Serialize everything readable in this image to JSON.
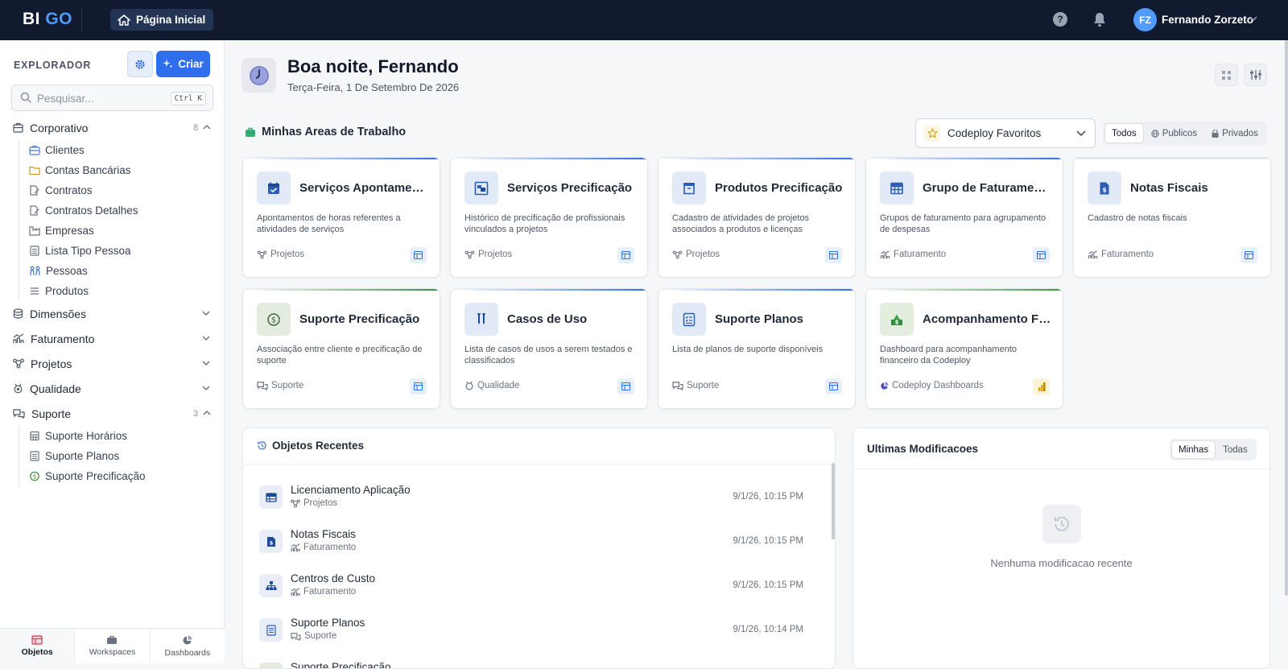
{
  "brand": {
    "bi": "BI",
    "go": "GO"
  },
  "topbar": {
    "home_label": "Página Inicial",
    "help": "?",
    "user_initials": "FZ",
    "user_name": "Fernando Zorzeto"
  },
  "sidebar": {
    "title": "EXPLORADOR",
    "create_label": "Criar",
    "search_placeholder": "Pesquisar...",
    "search_shortcut": "Ctrl K",
    "groups": [
      {
        "label": "Corporativo",
        "count": "8",
        "items": [
          "Clientes",
          "Contas Bancárias",
          "Contratos",
          "Contratos Detalhes",
          "Empresas",
          "Lista Tipo Pessoa",
          "Pessoas",
          "Produtos"
        ]
      },
      {
        "label": "Dimensões"
      },
      {
        "label": "Faturamento"
      },
      {
        "label": "Projetos"
      },
      {
        "label": "Qualidade"
      },
      {
        "label": "Suporte",
        "count": "3",
        "items": [
          "Suporte Horários",
          "Suporte Planos",
          "Suporte Precificação"
        ]
      }
    ],
    "bottom_nav": [
      "Objetos",
      "Workspaces",
      "Dashboards"
    ]
  },
  "main": {
    "greeting": "Boa noite, Fernando",
    "date": "Terça-Feira, 1 De Setembro De 2026",
    "section_title": "Minhas Areas de Trabalho",
    "favorites_select": "Codeploy Favoritos",
    "filters": [
      "Todos",
      "Publicos",
      "Privados"
    ],
    "cards": [
      {
        "title": "Serviços Apontamen...",
        "desc": "Apontamentos de horas referentes a atividades de serviços",
        "tag": "Projetos"
      },
      {
        "title": "Serviços Precificação",
        "desc": "Histórico de precificação de profissionais vinculados a projetos",
        "tag": "Projetos"
      },
      {
        "title": "Produtos Precificação",
        "desc": "Cadastro de atividades de projetos associados a produtos e licenças",
        "tag": "Projetos"
      },
      {
        "title": "Grupo de Faturamento",
        "desc": "Grupos de faturamento para agrupamento de despesas",
        "tag": "Faturamento"
      },
      {
        "title": "Notas Fiscais",
        "desc": "Cadastro de notas fiscais",
        "tag": "Faturamento"
      },
      {
        "title": "Suporte Precificação",
        "desc": "Associação entre cliente e precificação de suporte",
        "tag": "Suporte"
      },
      {
        "title": "Casos de Uso",
        "desc": "Lista de casos de usos a serem testados e classificados",
        "tag": "Qualidade"
      },
      {
        "title": "Suporte Planos",
        "desc": "Lista de planos de suporte disponíveis",
        "tag": "Suporte"
      },
      {
        "title": "Acompanhamento Fi...",
        "desc": "Dashboard para acompanhamento financeiro da Codeploy",
        "tag": "Codeploy Dashboards"
      }
    ],
    "recent": {
      "title": "Objetos Recentes",
      "rows": [
        {
          "name": "Licenciamento Aplicação",
          "sub": "Projetos",
          "time": "9/1/26, 10:15 PM"
        },
        {
          "name": "Notas Fiscais",
          "sub": "Faturamento",
          "time": "9/1/26, 10:15 PM"
        },
        {
          "name": "Centros de Custo",
          "sub": "Faturamento",
          "time": "9/1/26, 10:15 PM"
        },
        {
          "name": "Suporte Planos",
          "sub": "Suporte",
          "time": "9/1/26, 10:14 PM"
        },
        {
          "name": "Suporte Precificação"
        }
      ]
    },
    "modifications": {
      "title": "Ultimas Modificacoes",
      "filters": [
        "Minhas",
        "Todas"
      ],
      "empty": "Nenhuma modificacao recente"
    }
  },
  "colors": {
    "topbar": "#111a2e",
    "accent": "#2f6fed",
    "brand_go": "#4f9bff"
  }
}
